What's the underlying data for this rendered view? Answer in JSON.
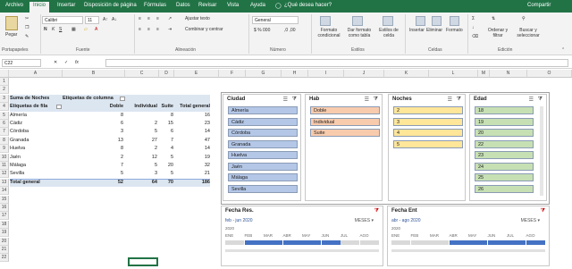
{
  "ribbon": {
    "tabs": [
      "Archivo",
      "Inicio",
      "Insertar",
      "Disposición de página",
      "Fórmulas",
      "Datos",
      "Revisar",
      "Vista",
      "Ayuda"
    ],
    "active_tab": "Inicio",
    "tell_me": "¿Qué desea hacer?",
    "share": "Compartir",
    "paste": "Pegar",
    "font_name": "Calibri",
    "font_size": "11",
    "wrap_text": "Ajustar texto",
    "merge_center": "Combinar y centrar",
    "number_format": "General",
    "conditional_format": "Formato condicional",
    "format_table": "Dar formato como tabla",
    "cell_styles": "Estilos de celda",
    "insert": "Insertar",
    "delete": "Eliminar",
    "format": "Formato",
    "sort_filter": "Ordenar y filtrar",
    "find_select": "Buscar y seleccionar",
    "groups": [
      "Portapapeles",
      "Fuente",
      "Alineación",
      "Número",
      "Estilos",
      "Celdas",
      "Edición"
    ]
  },
  "formula_bar": {
    "name_box": "C22",
    "fx": "fx",
    "value": ""
  },
  "columns": [
    "A",
    "B",
    "C",
    "D",
    "E",
    "F",
    "G",
    "H",
    "I",
    "J",
    "K",
    "L",
    "M",
    "N",
    "O"
  ],
  "rows": [
    "1",
    "2",
    "3",
    "4",
    "5",
    "6",
    "7",
    "8",
    "9",
    "10",
    "11",
    "12",
    "13",
    "14",
    "15",
    "16",
    "17",
    "18",
    "19",
    "20",
    "21",
    "22"
  ],
  "pivot": {
    "header1": [
      "Suma de Noches",
      "Etiquetas de columna"
    ],
    "header2": [
      "Etiquetas de fila",
      "Doble",
      "Individual",
      "Suite",
      "Total general"
    ],
    "rows": [
      [
        "Almería",
        "8",
        "",
        "8",
        "16"
      ],
      [
        "Cádiz",
        "6",
        "2",
        "15",
        "23"
      ],
      [
        "Córdoba",
        "3",
        "5",
        "6",
        "14"
      ],
      [
        "Granada",
        "13",
        "27",
        "7",
        "47"
      ],
      [
        "Huelva",
        "8",
        "2",
        "4",
        "14"
      ],
      [
        "Jaén",
        "2",
        "12",
        "5",
        "19"
      ],
      [
        "Málaga",
        "7",
        "5",
        "20",
        "32"
      ],
      [
        "Sevilla",
        "5",
        "3",
        "5",
        "21"
      ]
    ],
    "total": [
      "Total general",
      "52",
      "64",
      "70",
      "186"
    ]
  },
  "slicers": [
    {
      "title": "Ciudad",
      "items": [
        "Almería",
        "Cádiz",
        "Córdoba",
        "Granada",
        "Huelva",
        "Jaén",
        "Málaga",
        "Sevilla"
      ],
      "color": "#b4c7e7"
    },
    {
      "title": "Hab",
      "items": [
        "Doble",
        "Individual",
        "Suite"
      ],
      "color": "#f8cbad"
    },
    {
      "title": "Noches",
      "items": [
        "2",
        "3",
        "4",
        "5"
      ],
      "color": "#ffe699"
    },
    {
      "title": "Edad",
      "items": [
        "18",
        "19",
        "20",
        "22",
        "23",
        "24",
        "25",
        "26"
      ],
      "color": "#c6e0b4"
    }
  ],
  "timelines": [
    {
      "title": "Fecha Res.",
      "range": "feb - jun 2020",
      "level": "MESES",
      "year": "2020",
      "months": [
        "ENE",
        "FEB",
        "MAR",
        "ABR",
        "MAY",
        "JUN",
        "JUL",
        "AGO"
      ]
    },
    {
      "title": "Fecha Ent",
      "range": "abr - ago 2020",
      "level": "MESES",
      "year": "2020",
      "months": [
        "ENE",
        "FEB",
        "MAR",
        "ABR",
        "MAY",
        "JUN",
        "JUL",
        "AGO"
      ]
    }
  ],
  "colors": {
    "excel_green": "#217346",
    "pivot_header": "#dce6f1",
    "timeline_fill": "#4472c4"
  }
}
